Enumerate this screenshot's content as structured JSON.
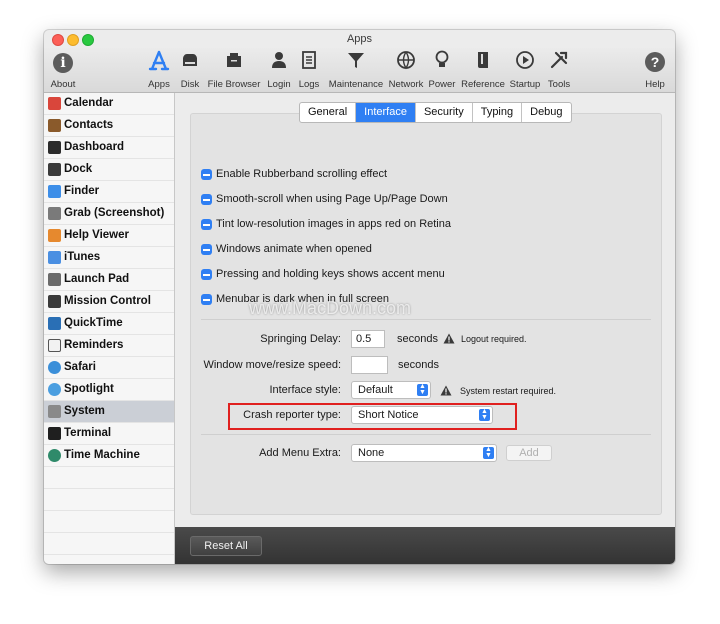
{
  "window": {
    "title": "Apps"
  },
  "toolbar": {
    "items": [
      {
        "label": "About",
        "icon": "info-icon"
      },
      {
        "label": "Apps",
        "icon": "app-store-icon"
      },
      {
        "label": "Disk",
        "icon": "disk-icon"
      },
      {
        "label": "File Browser",
        "icon": "file-cabinet-icon"
      },
      {
        "label": "Login",
        "icon": "user-icon"
      },
      {
        "label": "Logs",
        "icon": "document-icon"
      },
      {
        "label": "Maintenance",
        "icon": "funnel-icon"
      },
      {
        "label": "Network",
        "icon": "network-icon"
      },
      {
        "label": "Power",
        "icon": "lightbulb-icon"
      },
      {
        "label": "Reference",
        "icon": "book-icon"
      },
      {
        "label": "Startup",
        "icon": "play-icon"
      },
      {
        "label": "Tools",
        "icon": "tools-icon"
      },
      {
        "label": "Help",
        "icon": "help-icon"
      }
    ]
  },
  "sidebar": {
    "items": [
      {
        "label": "Calendar",
        "color": "#d9463b"
      },
      {
        "label": "Contacts",
        "color": "#8a5a2b"
      },
      {
        "label": "Dashboard",
        "color": "#2b2b2b"
      },
      {
        "label": "Dock",
        "color": "#3a3a3a"
      },
      {
        "label": "Finder",
        "color": "#3d8ee8"
      },
      {
        "label": "Grab (Screenshot)",
        "color": "#7a7a7a"
      },
      {
        "label": "Help Viewer",
        "color": "#e6892e"
      },
      {
        "label": "iTunes",
        "color": "#4a8fe2"
      },
      {
        "label": "Launch Pad",
        "color": "#6a6a6a"
      },
      {
        "label": "Mission Control",
        "color": "#3a3a3a"
      },
      {
        "label": "QuickTime",
        "color": "#2a6fb5"
      },
      {
        "label": "Reminders",
        "color": "#f2f2f2"
      },
      {
        "label": "Safari",
        "color": "#3b8fd9"
      },
      {
        "label": "Spotlight",
        "color": "#4a9ee0"
      },
      {
        "label": "System",
        "color": "#8a8a8a"
      },
      {
        "label": "Terminal",
        "color": "#1f1f1f"
      },
      {
        "label": "Time Machine",
        "color": "#2f8a6a"
      }
    ],
    "selected": "System"
  },
  "tabs": [
    "General",
    "Interface",
    "Security",
    "Typing",
    "Debug"
  ],
  "active_tab": "Interface",
  "checkboxes": [
    "Enable Rubberband scrolling effect",
    "Smooth-scroll when using Page Up/Page Down",
    "Tint low-resolution images in apps red on Retina",
    "Windows animate when opened",
    "Pressing and holding keys shows accent menu",
    "Menubar is dark when in full screen"
  ],
  "settings": {
    "springing_delay": {
      "label": "Springing Delay:",
      "value": "0.5",
      "unit": "seconds",
      "note": "Logout required."
    },
    "window_speed": {
      "label": "Window move/resize speed:",
      "value": "",
      "unit": "seconds"
    },
    "interface_style": {
      "label": "Interface style:",
      "value": "Default",
      "note": "System restart required."
    },
    "crash_reporter": {
      "label": "Crash reporter type:",
      "value": "Short Notice"
    },
    "menu_extra": {
      "label": "Add Menu Extra:",
      "value": "None",
      "button": "Add"
    }
  },
  "footer": {
    "reset_label": "Reset All"
  },
  "watermark": "www.MacDown.com",
  "colors": {
    "accent": "#2f7ff3",
    "highlight": "#e0201f"
  }
}
